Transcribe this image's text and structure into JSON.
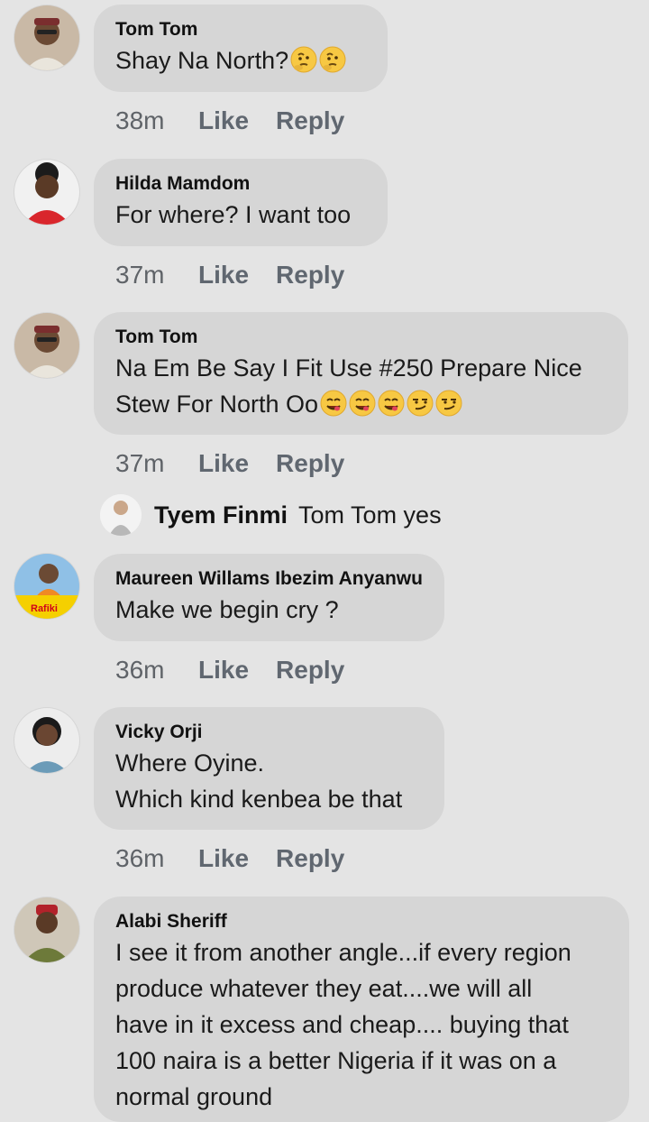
{
  "comments": [
    {
      "author": "Tom Tom",
      "lines": [
        "Shay Na North?"
      ],
      "time": "38m"
    },
    {
      "author": "Hilda Mamdom",
      "lines": [
        "For where? I want too"
      ],
      "time": "37m"
    },
    {
      "author": "Tom Tom",
      "lines": [
        "Na Em Be Say I Fit Use #250 Prepare Nice",
        "Stew For North Oo"
      ],
      "time": "37m"
    },
    {
      "author": "Maureen Willams Ibezim Anyanwu",
      "lines": [
        "Make we begin cry ?"
      ],
      "time": "36m"
    },
    {
      "author": "Vicky Orji",
      "lines": [
        "Where Oyine.",
        "Which kind kenbea be that"
      ],
      "time": "36m"
    },
    {
      "author": "Alabi Sheriff",
      "lines": [
        "I see it from another angle...if every region",
        "produce whatever they eat....we will all",
        "have in it excess and cheap.... buying that",
        "100 naira is a better Nigeria if it was on a",
        "normal ground"
      ],
      "time": ""
    }
  ],
  "reply_preview": {
    "author": "Tyem Finmi",
    "text": "Tom Tom yes"
  },
  "actions": {
    "like": "Like",
    "reply": "Reply"
  },
  "avatar_logo_text": "Rafiki",
  "icons": {
    "thinking": "thinking-face-icon",
    "yum": "face-savoring-food-icon",
    "smirk": "smirking-face-icon"
  }
}
